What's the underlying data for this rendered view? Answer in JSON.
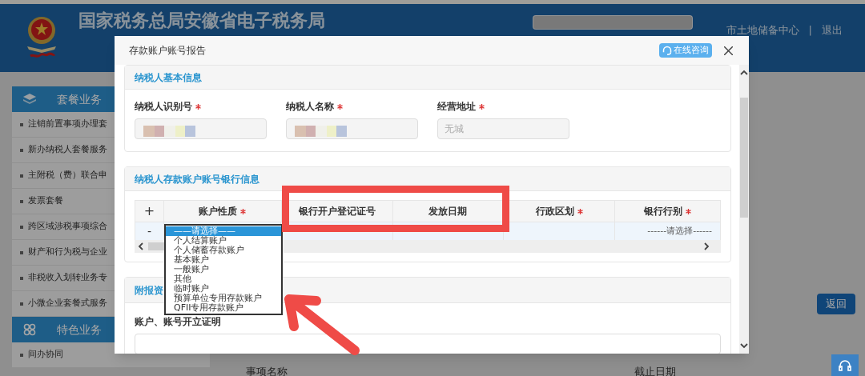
{
  "header": {
    "title": "国家税务总局安徽省电子税务局",
    "user": "市土地储备中心",
    "separator": "|",
    "logout": "退出"
  },
  "sidebar": {
    "groups": [
      {
        "title": "套餐业务",
        "items": [
          "注销前置事项办理套",
          "新办纳税人套餐服务",
          "主附税（费）联合申",
          "发票套餐",
          "跨区域涉税事项综合",
          "财产和行为税与企业",
          "非税收入划转业务专",
          "小微企业套餐式服务"
        ]
      },
      {
        "title": "特色业务",
        "items": [
          "间办协同"
        ]
      }
    ]
  },
  "main": {
    "back_button": "返回",
    "columns": [
      "事项名称",
      "截止日期"
    ]
  },
  "dialog": {
    "title": "存款账户账号报告",
    "consult_button": "在线咨询",
    "basic": {
      "title": "纳税人基本信息",
      "fields": [
        {
          "label": "纳税人识别号",
          "required": true,
          "kind": "redacted"
        },
        {
          "label": "纳税人名称",
          "required": true,
          "kind": "redacted"
        },
        {
          "label": "经营地址",
          "required": true,
          "kind": "text",
          "value": "无城",
          "disabled": true
        }
      ]
    },
    "bank": {
      "title": "纳税人存款账户账号银行信息",
      "add": "+",
      "remove": "-",
      "columns": [
        {
          "label": "账户性质",
          "required": true
        },
        {
          "label": "银行开户登记证号",
          "required": false
        },
        {
          "label": "发放日期",
          "required": false
        },
        {
          "label": "行政区划",
          "required": true
        },
        {
          "label": "银行行别",
          "required": true
        }
      ],
      "last_cell": "------请选择------",
      "dropdown": [
        {
          "label": "——请选择——",
          "selected": true
        },
        {
          "label": "个人结算账户",
          "selected": false
        },
        {
          "label": "个人储蓄存款账户",
          "selected": false
        },
        {
          "label": "基本账户",
          "selected": false
        },
        {
          "label": "一般账户",
          "selected": false
        },
        {
          "label": "其他",
          "selected": false
        },
        {
          "label": "临时账户",
          "selected": false
        },
        {
          "label": "预算单位专用存款账户",
          "selected": false
        },
        {
          "label": "QFII专用存款账户",
          "selected": false
        }
      ]
    },
    "attach": {
      "title": "附报资",
      "field_label": "账户、账号开立证明"
    }
  }
}
